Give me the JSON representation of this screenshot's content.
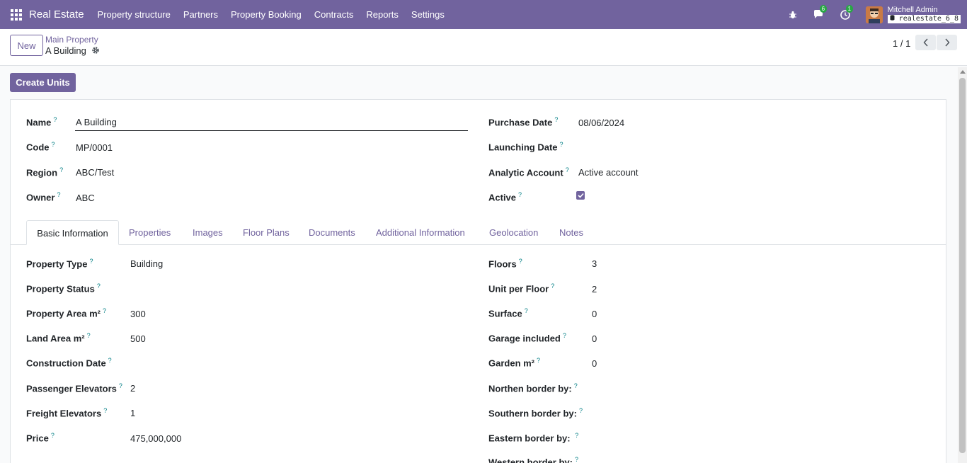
{
  "nav": {
    "brand": "Real Estate",
    "menu": [
      "Property structure",
      "Partners",
      "Property Booking",
      "Contracts",
      "Reports",
      "Settings"
    ],
    "messages_count": "6",
    "activities_count": "1",
    "user_name": "Mitchell Admin",
    "db_name": "realestate_6_8"
  },
  "control": {
    "new_label": "New",
    "breadcrumb_parent": "Main Property",
    "breadcrumb_current": "A Building",
    "pager": "1 / 1"
  },
  "actions": {
    "create_units_label": "Create Units"
  },
  "header_fields": {
    "name_label": "Name",
    "name_value": "A Building",
    "code_label": "Code",
    "code_value": "MP/0001",
    "region_label": "Region",
    "region_value": "ABC/Test",
    "owner_label": "Owner",
    "owner_value": "ABC",
    "purchase_date_label": "Purchase Date",
    "purchase_date_value": "08/06/2024",
    "launching_date_label": "Launching Date",
    "analytic_account_label": "Analytic Account",
    "analytic_account_value": "Active account",
    "active_label": "Active",
    "active_checked": true
  },
  "tabs": [
    "Basic Information",
    "Properties",
    "Images",
    "Floor Plans",
    "Documents",
    "Additional Information",
    "Geolocation",
    "Notes"
  ],
  "basic_info": {
    "left": [
      {
        "label": "Property Type",
        "value": "Building"
      },
      {
        "label": "Property Status",
        "value": ""
      },
      {
        "label": "Property Area m²",
        "value": "300"
      },
      {
        "label": "Land Area m²",
        "value": "500"
      },
      {
        "label": "Construction Date",
        "value": ""
      },
      {
        "label": "Passenger Elevators",
        "value": "2"
      },
      {
        "label": "Freight Elevators",
        "value": "1"
      },
      {
        "label": "Price",
        "value": "475,000,000"
      }
    ],
    "right": [
      {
        "label": "Floors",
        "value": "3"
      },
      {
        "label": "Unit per Floor",
        "value": "2"
      },
      {
        "label": "Surface",
        "value": "0"
      },
      {
        "label": "Garage included",
        "value": "0"
      },
      {
        "label": "Garden m²",
        "value": "0"
      },
      {
        "label": "Northen border by:",
        "value": ""
      },
      {
        "label": "Southern border by:",
        "value": ""
      },
      {
        "label": "Eastern border by: ",
        "value": ""
      },
      {
        "label": "Western border by:",
        "value": ""
      }
    ]
  },
  "help_mark": "?",
  "colors": {
    "brand": "#71639e",
    "help": "#017e84"
  }
}
